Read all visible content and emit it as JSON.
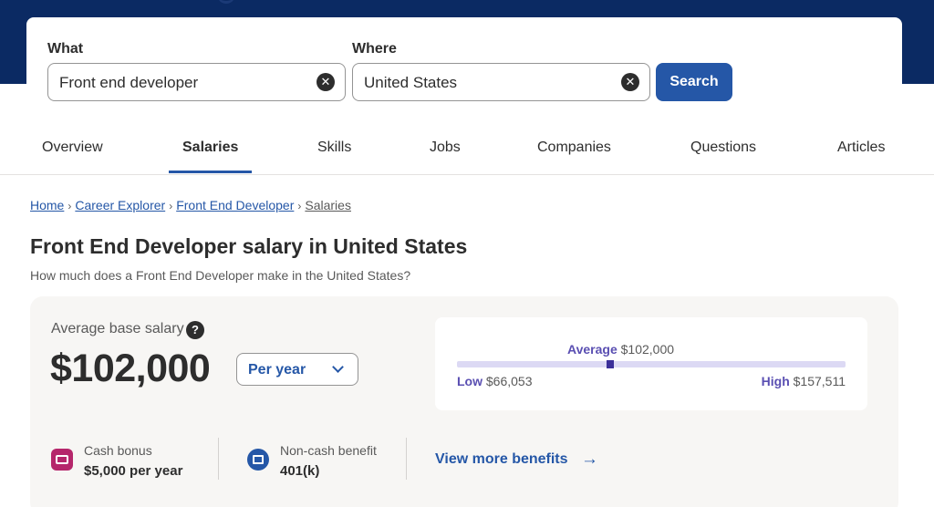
{
  "search": {
    "what_label": "What",
    "what_value": "Front end developer",
    "where_label": "Where",
    "where_value": "United States",
    "search_label": "Search",
    "clear_glyph": "✕"
  },
  "tabs": [
    {
      "label": "Overview"
    },
    {
      "label": "Salaries"
    },
    {
      "label": "Skills"
    },
    {
      "label": "Jobs"
    },
    {
      "label": "Companies"
    },
    {
      "label": "Questions"
    },
    {
      "label": "Articles"
    }
  ],
  "breadcrumb": [
    "Home",
    "Career Explorer",
    "Front End Developer",
    "Salaries"
  ],
  "page": {
    "title": "Front End Developer salary in United States",
    "subtitle": "How much does a Front End Developer make in the United States?"
  },
  "salary": {
    "avg_label": "Average base salary",
    "help_glyph": "?",
    "amount": "$102,000",
    "period": "Per year",
    "range": {
      "average_label": "Average",
      "average_value": "$102,000",
      "low_label": "Low",
      "low_value": "$66,053",
      "high_label": "High",
      "high_value": "$157,511"
    }
  },
  "benefits": {
    "cash_title": "Cash bonus",
    "cash_value": "$5,000 per year",
    "noncash_title": "Non-cash benefit",
    "noncash_value": "401(k)",
    "more_label": "View more benefits",
    "arrow_glyph": "→"
  },
  "colors": {
    "brand_navy": "#0b2a63",
    "primary_blue": "#2557a7",
    "range_purple": "#5a4fb2",
    "cash_pink": "#b5266b"
  }
}
